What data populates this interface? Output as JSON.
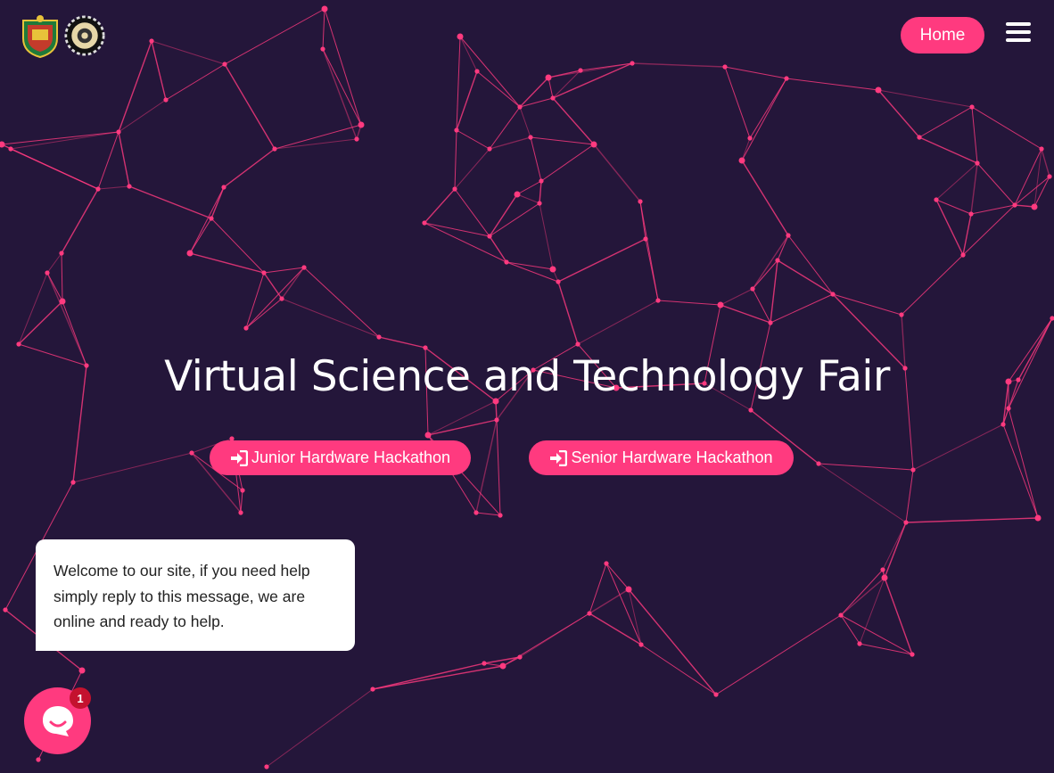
{
  "header": {
    "logos": [
      "crest-logo",
      "gear-logo"
    ],
    "home_label": "Home",
    "menu_icon": "hamburger-menu-icon"
  },
  "hero": {
    "title": "Virtual Science and Technology Fair",
    "buttons": [
      {
        "label": "Junior Hardware Hackathon",
        "icon": "sign-in-icon"
      },
      {
        "label": "Senior Hardware Hackathon",
        "icon": "sign-in-icon"
      }
    ]
  },
  "chat": {
    "message": "Welcome to our site, if you need help simply reply to this message, we are online and ready to help.",
    "unread_count": "1",
    "launcher_icon": "chat-icon"
  },
  "colors": {
    "background": "#24163a",
    "accent": "#ff3a7f",
    "badge": "#c4122f",
    "network_line": "#ff3a7f"
  }
}
